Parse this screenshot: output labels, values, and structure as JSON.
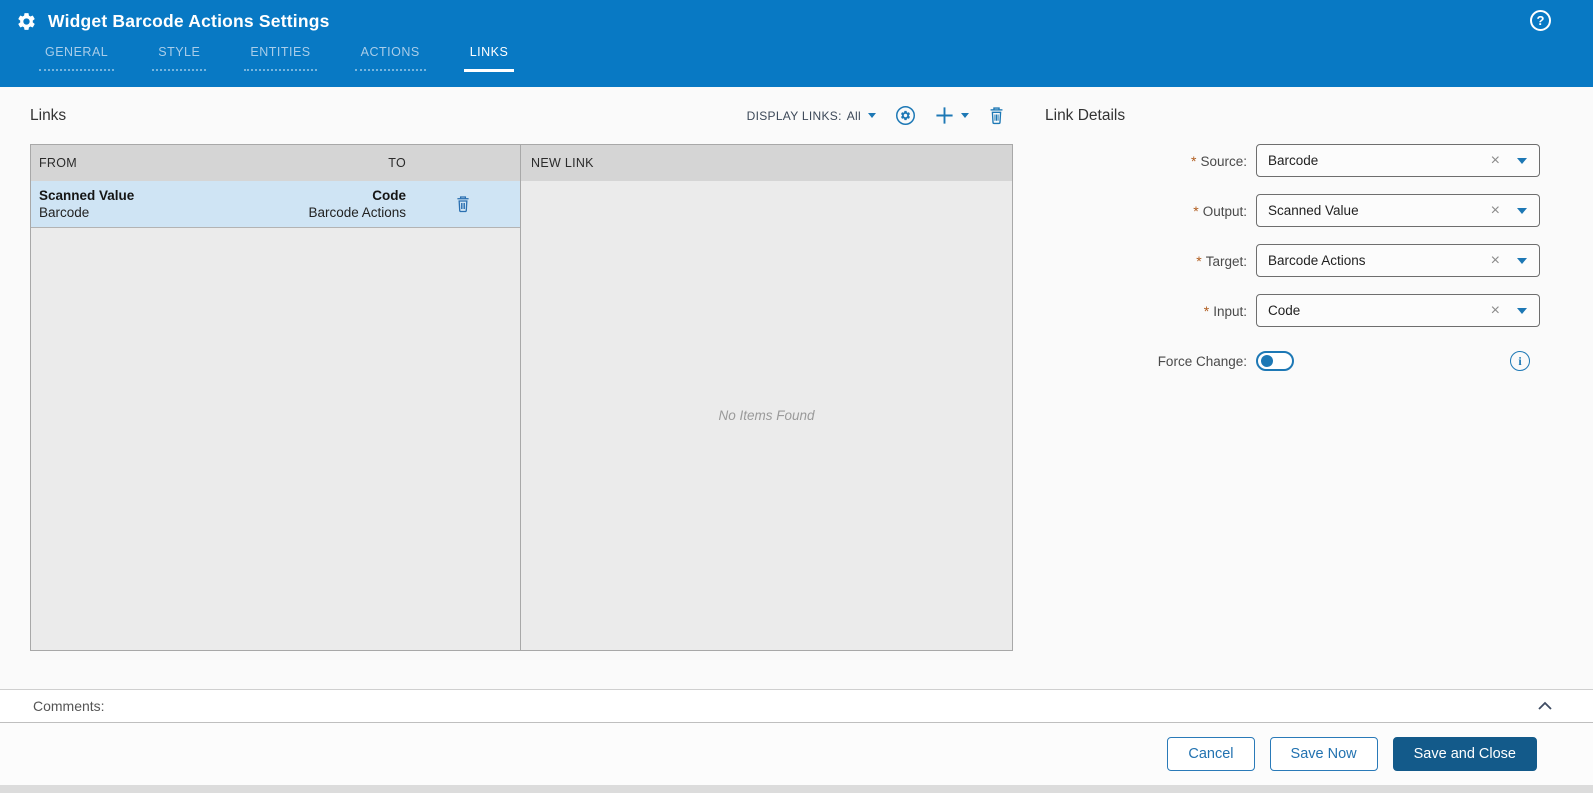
{
  "colors": {
    "header_bg": "#0879c4",
    "accent_blue": "#1d78b5",
    "primary_button_bg": "#135a8a",
    "selected_row_bg": "#cfe4f4"
  },
  "icons": {
    "help": "?",
    "clear": "×",
    "info": "i"
  },
  "header": {
    "title": "Widget Barcode Actions Settings",
    "active_tab": "LINKS",
    "tabs": [
      {
        "label": "GENERAL"
      },
      {
        "label": "STYLE"
      },
      {
        "label": "ENTITIES"
      },
      {
        "label": "ACTIONS"
      },
      {
        "label": "LINKS"
      }
    ]
  },
  "links_section": {
    "title": "Links",
    "toolbar": {
      "display_links_label": "DISPLAY LINKS:",
      "display_links_value": "All"
    },
    "table": {
      "from_header": "FROM",
      "to_header": "TO",
      "rows": [
        {
          "from_primary": "Scanned Value",
          "from_secondary": "Barcode",
          "to_primary": "Code",
          "to_secondary": "Barcode Actions"
        }
      ]
    },
    "new_link_panel": {
      "header": "NEW LINK",
      "empty_text": "No Items Found"
    }
  },
  "link_details": {
    "title": "Link Details",
    "required_marker": "*",
    "fields": [
      {
        "label": "Source:",
        "value": "Barcode"
      },
      {
        "label": "Output:",
        "value": "Scanned Value"
      },
      {
        "label": "Target:",
        "value": "Barcode Actions"
      },
      {
        "label": "Input:",
        "value": "Code"
      }
    ],
    "force_change": {
      "label": "Force Change:",
      "enabled": false
    }
  },
  "comments": {
    "label": "Comments:"
  },
  "footer": {
    "cancel_label": "Cancel",
    "save_now_label": "Save Now",
    "save_and_close_label": "Save and Close"
  }
}
